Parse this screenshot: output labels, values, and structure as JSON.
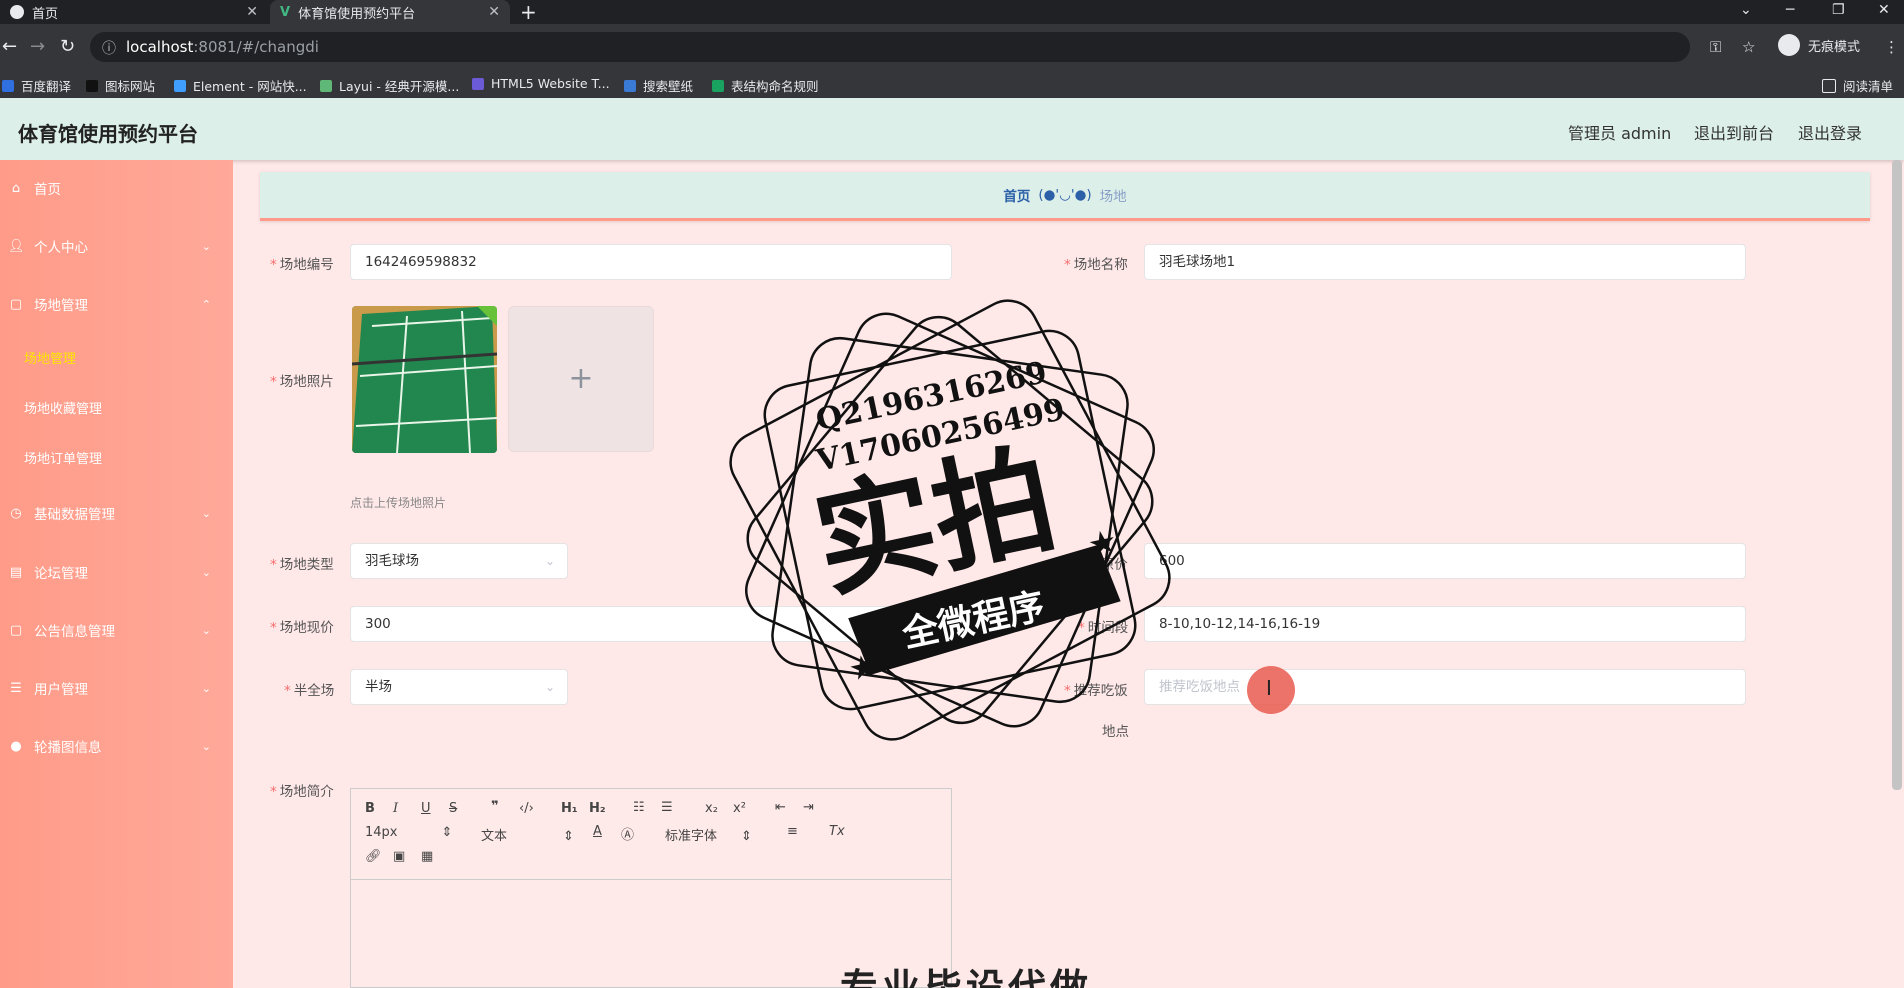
{
  "browser": {
    "tabs": [
      {
        "label": "首页",
        "active": false
      },
      {
        "label": "体育馆使用预约平台",
        "active": true
      }
    ],
    "url_host": "localhost",
    "url_path": ":8081/#/changdi",
    "incognito_label": "无痕模式",
    "reading_list": "阅读清单",
    "bookmarks": [
      "百度翻译",
      "图标网站",
      "Element - 网站快...",
      "Layui - 经典开源模...",
      "HTML5 Website T...",
      "搜索壁纸",
      "表结构命名规则"
    ]
  },
  "header": {
    "title": "体育馆使用预约平台",
    "user": "管理员 admin",
    "to_front": "退出到前台",
    "logout": "退出登录"
  },
  "sidebar": {
    "items": [
      {
        "label": "首页",
        "icon": "home-icon"
      },
      {
        "label": "个人中心",
        "icon": "user-icon"
      },
      {
        "label": "场地管理",
        "icon": "grid-icon"
      },
      {
        "label": "基础数据管理",
        "icon": "clock-icon"
      },
      {
        "label": "论坛管理",
        "icon": "forum-icon"
      },
      {
        "label": "公告信息管理",
        "icon": "notice-icon"
      },
      {
        "label": "用户管理",
        "icon": "list-icon"
      },
      {
        "label": "轮播图信息",
        "icon": "pin-icon"
      }
    ],
    "subitems": [
      "场地管理",
      "场地收藏管理",
      "场地订单管理"
    ]
  },
  "breadcrumb": {
    "home": "首页",
    "sep": "(●'◡'●)",
    "current": "场地"
  },
  "form": {
    "code_label": "场地编号",
    "code_value": "1642469598832",
    "name_label": "场地名称",
    "name_value": "羽毛球场地1",
    "photo_label": "场地照片",
    "photo_hint": "点击上传场地照片",
    "type_label": "场地类型",
    "type_value": "羽毛球场",
    "orig_price_label": "场地原价",
    "orig_price_value": "600",
    "cur_price_label": "场地现价",
    "cur_price_value": "300",
    "time_label": "时间段",
    "time_value": "8-10,10-12,14-16,16-19",
    "half_label": "半全场",
    "half_value": "半场",
    "food_label": "推荐吃饭",
    "food_label2": "地点",
    "food_placeholder": "推荐吃饭地点",
    "intro_label": "场地简介"
  },
  "editor": {
    "font_size": "14px",
    "block": "文本",
    "font": "标准字体"
  },
  "watermark": {
    "qq": "Q2196316269",
    "wx": "V17060256499",
    "main": "实拍",
    "band": "全微程序",
    "bottom": "专业毕设代做"
  },
  "colors": {
    "sidebar": "#ff9b88",
    "header": "#dcefe9",
    "content_bg": "#ffe8e8",
    "active_sub": "#ffe600"
  }
}
